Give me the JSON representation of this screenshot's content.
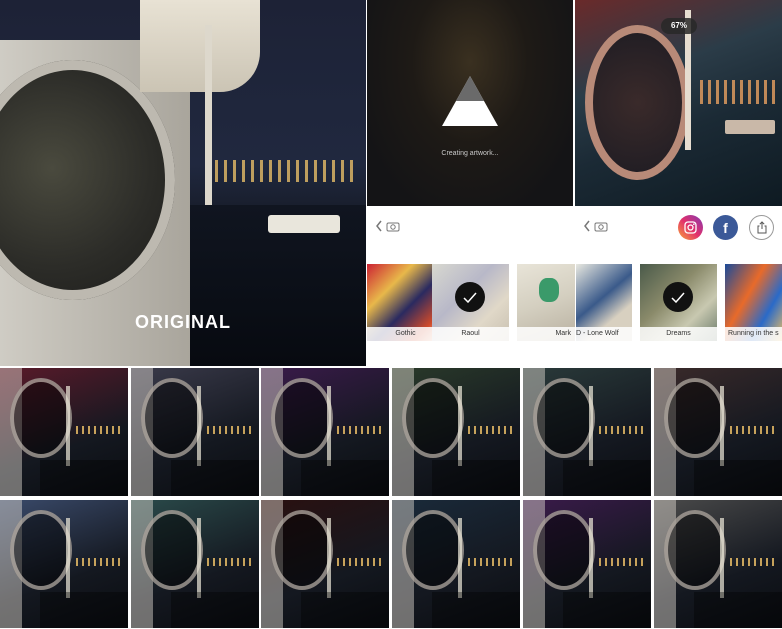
{
  "original": {
    "label": "ORIGINAL"
  },
  "creating": {
    "status_text": "Creating artwork..."
  },
  "result": {
    "progress_badge": "67%",
    "progress": 0.67
  },
  "action_bar": {
    "left_group": {
      "back_icon": "chevron-left-icon",
      "camera_icon": "camera-icon"
    },
    "right_group": {
      "back_icon": "chevron-left-icon",
      "camera_icon": "camera-icon"
    },
    "share_targets": [
      {
        "name": "instagram-icon",
        "color": "#c13584"
      },
      {
        "name": "facebook-icon",
        "label": "f",
        "color": "#3b5998"
      },
      {
        "name": "share-icon",
        "color": "#ffffff"
      }
    ]
  },
  "filters": [
    {
      "label": "Gothic",
      "selected": false
    },
    {
      "label": "Raoul",
      "selected": true
    },
    {
      "label": "Mark",
      "selected": false
    },
    {
      "label": "D - Lone Wolf",
      "selected": false
    },
    {
      "label": "Dreams",
      "selected": true
    },
    {
      "label": "Running in the s",
      "selected": false
    }
  ],
  "grid_styles": [
    [
      "#5a1a2a",
      "#3a3a4a",
      "#3a1a4a",
      "#2a3a2a",
      "#2a3a3a",
      "#3a2a2a"
    ],
    [
      "#3a4a6a",
      "#2a4a4a",
      "#2a1010",
      "#1a2a3a",
      "#3a1a4a",
      "#4a4a4a"
    ]
  ],
  "colors": {
    "accent": "#3b5998",
    "instagram": "#c13584",
    "checkmark_bg": "#111111"
  }
}
